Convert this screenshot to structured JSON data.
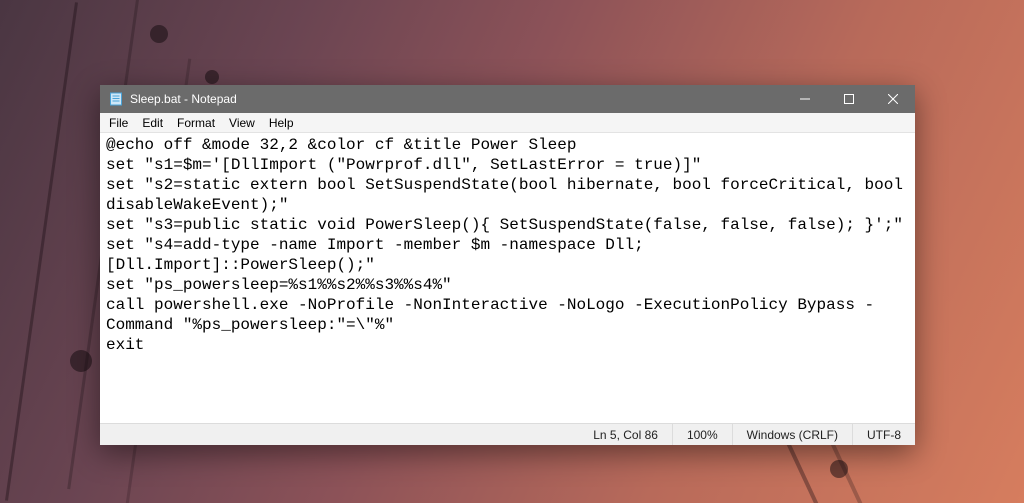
{
  "titlebar": {
    "title": "Sleep.bat - Notepad"
  },
  "menu": {
    "items": [
      "File",
      "Edit",
      "Format",
      "View",
      "Help"
    ]
  },
  "editor": {
    "content": "@echo off &mode 32,2 &color cf &title Power Sleep\nset \"s1=$m='[DllImport (\"Powrprof.dll\", SetLastError = true)]\"\nset \"s2=static extern bool SetSuspendState(bool hibernate, bool forceCritical, bool disableWakeEvent);\"\nset \"s3=public static void PowerSleep(){ SetSuspendState(false, false, false); }';\"\nset \"s4=add-type -name Import -member $m -namespace Dll; [Dll.Import]::PowerSleep();\"\nset \"ps_powersleep=%s1%%s2%%s3%%s4%\"\ncall powershell.exe -NoProfile -NonInteractive -NoLogo -ExecutionPolicy Bypass -Command \"%ps_powersleep:\"=\\\"%\"\nexit"
  },
  "statusbar": {
    "position": "Ln 5, Col 86",
    "zoom": "100%",
    "line_ending": "Windows (CRLF)",
    "encoding": "UTF-8"
  }
}
